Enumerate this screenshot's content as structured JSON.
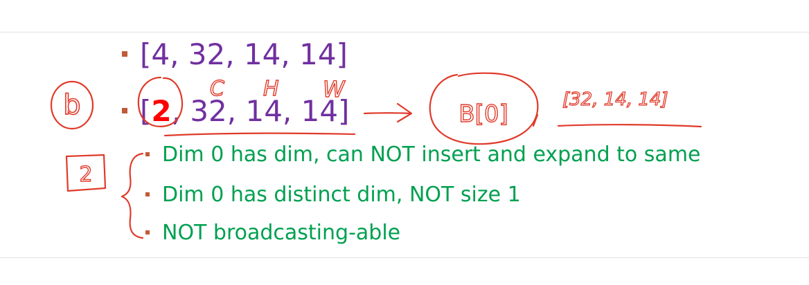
{
  "slide": {
    "bullets": [
      {
        "level": 1,
        "text": "[4, 32, 14, 14]"
      },
      {
        "level": 1,
        "open_bracket": "[",
        "highlight": "2",
        "rest": ", 32, 14, 14]"
      },
      {
        "level": 2,
        "text": "Dim 0 has dim, can NOT insert and expand to same"
      },
      {
        "level": 2,
        "text": "Dim 0 has distinct dim, NOT size 1"
      },
      {
        "level": 2,
        "text": "NOT broadcasting-able"
      }
    ],
    "colors": {
      "level1_text": "#7030a0",
      "level2_text": "#00a050",
      "highlight": "#ff0000",
      "bullet": "#c05a38",
      "ink": "#e03a2a"
    }
  },
  "annotations": {
    "circled_b": "b",
    "boxed_number": "2",
    "dim_labels": [
      "C",
      "H",
      "W"
    ],
    "circled_index": "B[0]",
    "result_shape": "[32, 14, 14]"
  }
}
